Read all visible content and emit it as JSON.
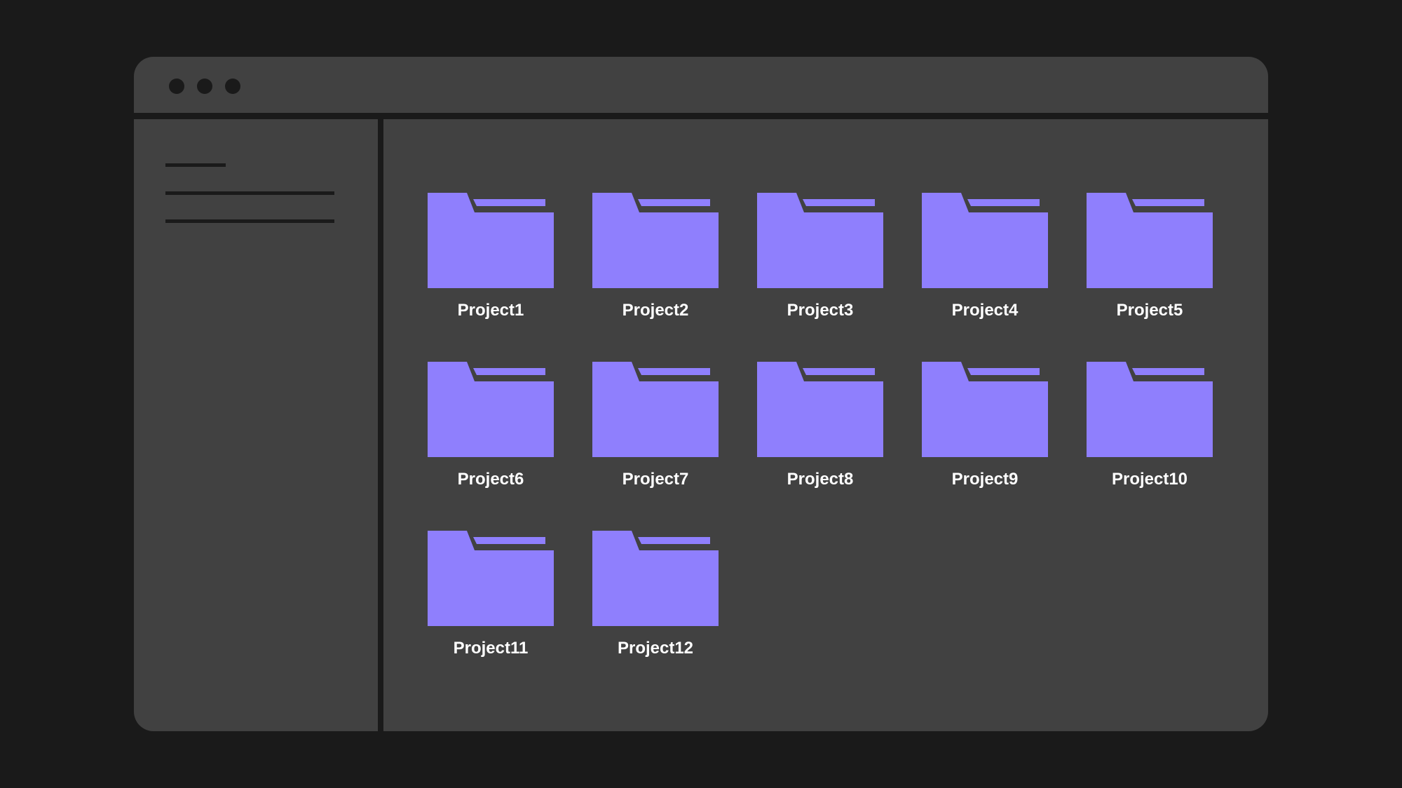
{
  "window": {
    "controls": [
      "close-dot",
      "minimize-dot",
      "maximize-dot"
    ]
  },
  "colors": {
    "background": "#1a1a1a",
    "panel": "#414141",
    "folder": "#8f7ffd",
    "label": "#ffffff"
  },
  "folders": [
    {
      "label": "Project1",
      "icon": "folder-icon"
    },
    {
      "label": "Project2",
      "icon": "folder-icon"
    },
    {
      "label": "Project3",
      "icon": "folder-icon"
    },
    {
      "label": "Project4",
      "icon": "folder-icon"
    },
    {
      "label": "Project5",
      "icon": "folder-icon"
    },
    {
      "label": "Project6",
      "icon": "folder-icon"
    },
    {
      "label": "Project7",
      "icon": "folder-icon"
    },
    {
      "label": "Project8",
      "icon": "folder-icon"
    },
    {
      "label": "Project9",
      "icon": "folder-icon"
    },
    {
      "label": "Project10",
      "icon": "folder-icon"
    },
    {
      "label": "Project11",
      "icon": "folder-icon"
    },
    {
      "label": "Project12",
      "icon": "folder-icon"
    }
  ]
}
